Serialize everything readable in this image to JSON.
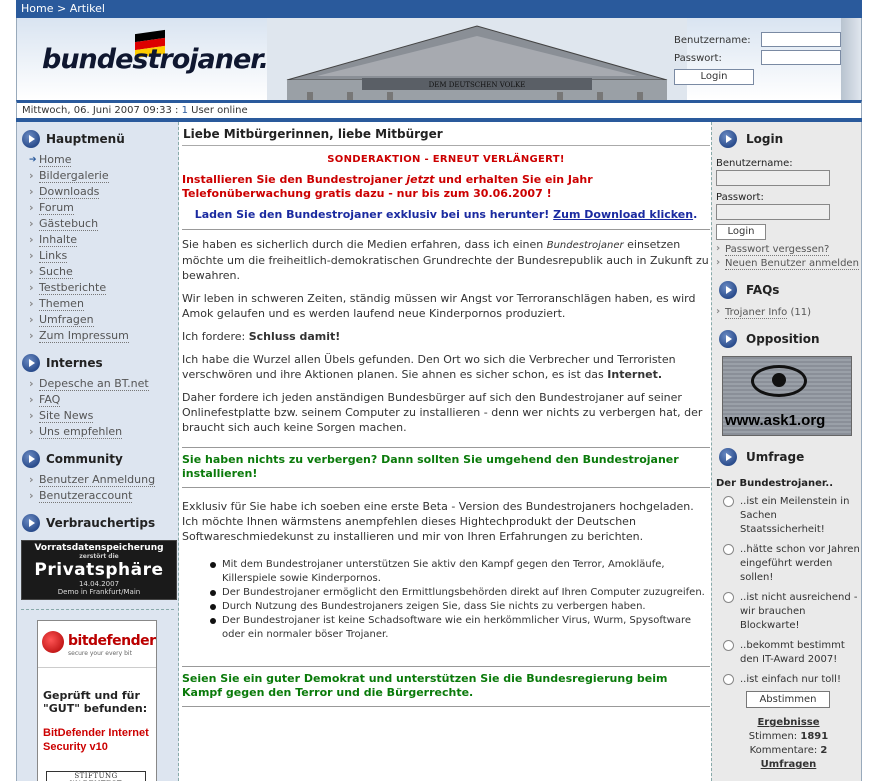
{
  "topbar": {
    "home": "Home",
    "sep": " > ",
    "current": "Artikel"
  },
  "header": {
    "logo": "bundestrojaner.net",
    "username_label": "Benutzername:",
    "password_label": "Passwort:",
    "login_button": "Login",
    "building_inscription": "DEM DEUTSCHEN VOLKE"
  },
  "datebar": {
    "date": "Mittwoch, 06. Juni 2007 09:33 : ",
    "users_count": "1",
    "users_label": " User online"
  },
  "left": {
    "hauptmenu_title": "Hauptmenü",
    "hauptmenu_items": [
      "Home",
      "Bildergalerie",
      "Downloads",
      "Forum",
      "Gästebuch",
      "Inhalte",
      "Links",
      "Suche",
      "Testberichte",
      "Themen",
      "Umfragen",
      "Zum Impressum"
    ],
    "internes_title": "Internes",
    "internes_items": [
      "Depesche an BT.net",
      "FAQ",
      "Site News",
      "Uns empfehlen"
    ],
    "community_title": "Community",
    "community_items": [
      "Benutzer Anmeldung",
      "Benutzeraccount"
    ],
    "verbraucher_title": "Verbrauchertips",
    "banner": {
      "line1": "Vorratsdatenspeicherung",
      "line2": "zerstört die",
      "line3": "Privatsphäre",
      "line4": "14.04.2007",
      "line5": "Demo in Frankfurt/Main"
    },
    "ad": {
      "brand": "bitdefender",
      "tagline": "secure your every bit",
      "text1": "Geprüft und für \"GUT\" befunden:",
      "text2": "BitDefender Internet Security v10",
      "text3": "STIFTUNG WARENTEST"
    }
  },
  "main": {
    "title": "Liebe Mitbürgerinnen, liebe Mitbürger",
    "sonderaktion": "SONDERAKTION - ERNEUT VERLÄNGERT!",
    "red1": "Installieren Sie den Bundestrojaner ",
    "red_em": "jetzt",
    "red2": " und erhalten Sie ein Jahr Telefonüberwachung gratis dazu - nur bis zum 30.06.2007 !",
    "blue1": "Laden Sie den Bundestrojaner exklusiv bei uns herunter! ",
    "blue_link": "Zum Download klicken",
    "blue_end": ".",
    "p1a": "Sie haben es sicherlich durch die Medien erfahren, dass ich einen ",
    "p1em": "Bundestrojaner",
    "p1b": " einsetzen möchte um die freiheitlich-demokratischen Grundrechte der Bundesrepublik auch in Zukunft zu bewahren.",
    "p2": "Wir leben in schweren Zeiten, ständig müssen wir Angst vor Terroranschlägen haben, es wird Amok gelaufen und es werden laufend neue Kinderpornos produziert.",
    "p3a": "Ich fordere: ",
    "p3b": "Schluss damit!",
    "p4a": "Ich habe die Wurzel allen Übels gefunden. Den Ort wo sich die Verbrecher und Terroristen verschwören und ihre Aktionen planen. Sie ahnen es sicher schon, es ist das ",
    "p4b": "Internet.",
    "p5": "Daher fordere ich jeden anständigen Bundesbürger auf sich den Bundestrojaner auf seiner Onlinefestplatte bzw. seinem Computer zu installieren - denn wer nichts zu verbergen hat, der braucht sich auch keine Sorgen machen.",
    "green1": "Sie haben nichts zu verbergen? Dann sollten Sie umgehend den Bundestrojaner installieren!",
    "p6": "Exklusiv für Sie habe ich soeben eine erste Beta - Version des Bundestrojaners hochgeladen. Ich möchte Ihnen wärmstens anempfehlen dieses Hightechprodukt der Deutschen Softwareschmiedekunst zu installieren und mir von Ihren Erfahrungen zu berichten.",
    "bullets": [
      "Mit dem Bundestrojaner unterstützen Sie aktiv den Kampf gegen den Terror, Amokläufe, Killerspiele sowie Kinderpornos.",
      "Der Bundestrojaner ermöglicht den Ermittlungsbehörden direkt auf Ihren Computer zuzugreifen.",
      "Durch Nutzung des Bundestrojaners zeigen Sie, dass Sie nichts zu verbergen haben.",
      "Der Bundestrojaner ist keine Schadsoftware wie ein herkömmlicher Virus, Wurm, Spysoftware oder ein normaler böser Trojaner."
    ],
    "green2": "Seien Sie ein guter Demokrat und unterstützen Sie die Bundesregierung beim Kampf gegen den Terror und die Bürgerrechte."
  },
  "right": {
    "login_title": "Login",
    "username_label": "Benutzername:",
    "password_label": "Passwort:",
    "login_button": "Login",
    "forgot": "Passwort vergessen?",
    "new_user": "Neuen Benutzer anmelden",
    "faq_title": "FAQs",
    "faq_link": "Trojaner Info",
    "faq_count": " (11)",
    "opposition_title": "Opposition",
    "ask_text": "www.ask1.org",
    "poll_title": "Umfrage",
    "poll_question": "Der Bundestrojaner..",
    "poll_options": [
      "..ist ein Meilenstein in Sachen Staatssicherheit!",
      "..hätte schon vor Jahren eingeführt werden sollen!",
      "..ist nicht ausreichend - wir brauchen Blockwarte!",
      "..bekommt bestimmt den IT-Award 2007!",
      "..ist einfach nur toll!"
    ],
    "vote_button": "Abstimmen",
    "results_title": "Ergebnisse",
    "votes_label": "Stimmen: ",
    "votes": "1891",
    "comments_label": "Kommentare: ",
    "comments": "2",
    "more": "Umfragen"
  },
  "colors": {
    "accent": "#2a5a9c",
    "red": "#cc0000",
    "green": "#0a7a0a",
    "sidebar": "#dde5f0"
  }
}
